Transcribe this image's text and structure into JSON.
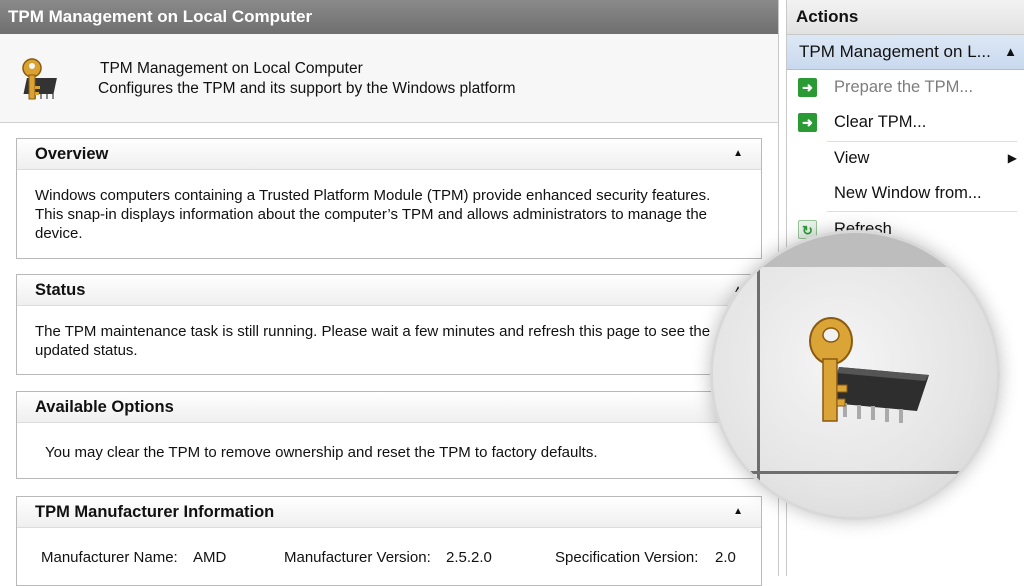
{
  "window": {
    "title": "TPM Management on Local Computer"
  },
  "header": {
    "title": "TPM Management on Local Computer",
    "description": "Configures the TPM and its support by the Windows platform"
  },
  "sections": {
    "overview": {
      "title": "Overview",
      "line1": "Windows computers containing a Trusted Platform Module (TPM) provide enhanced security features.",
      "line2": "This snap-in displays information about the computer’s TPM and allows administrators to manage the",
      "line3": "device."
    },
    "status": {
      "title": "Status",
      "line1": "The TPM maintenance task is still running. Please wait a few minutes and refresh this page to see the",
      "line2": "updated status."
    },
    "options": {
      "title": "Available Options",
      "text": "You may clear the TPM to remove ownership and reset the TPM to factory defaults."
    },
    "manufacturer": {
      "title": "TPM Manufacturer Information",
      "name_label": "Manufacturer Name:",
      "name_value": "AMD",
      "version_label": "Manufacturer Version:",
      "version_value": "2.5.2.0",
      "spec_label": "Specification Version:",
      "spec_value": "2.0"
    }
  },
  "actions": {
    "title": "Actions",
    "subtitle": "TPM Management on L...",
    "items": [
      {
        "label": "Prepare the TPM...",
        "icon": "green-arrow-icon",
        "enabled": false
      },
      {
        "label": "Clear TPM...",
        "icon": "green-arrow-icon",
        "enabled": true
      },
      {
        "label": "View",
        "icon": "submenu-arrow-icon",
        "enabled": true
      },
      {
        "label": "New Window from...",
        "icon": "",
        "enabled": true
      },
      {
        "label": "Refresh",
        "icon": "refresh-icon",
        "enabled": true
      }
    ]
  },
  "colors": {
    "title_bar": "#7a7a7a",
    "action_highlight": "#c9d9ee",
    "action_icon": "#2a9a35"
  }
}
